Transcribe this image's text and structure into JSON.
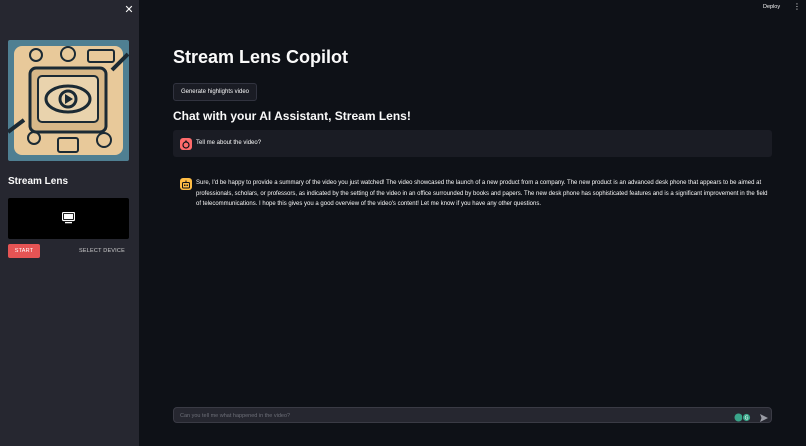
{
  "sidebar": {
    "title": "Stream Lens",
    "start_label": "START",
    "select_device_label": "SELECT DEVICE",
    "close_icon": "close-icon",
    "video_icon": "monitor-icon"
  },
  "topbar": {
    "deploy_label": "Deploy",
    "menu_icon": "vertical-dots-icon"
  },
  "main": {
    "title": "Stream Lens Copilot",
    "highlights_button_label": "Generate highlights video",
    "chat_heading": "Chat with your AI Assistant, Stream Lens!"
  },
  "chat": {
    "messages": [
      {
        "role": "user",
        "avatar_icon": "user-avatar-icon",
        "text": "Tell me about the video?"
      },
      {
        "role": "assistant",
        "avatar_icon": "assistant-avatar-icon",
        "text": "Sure, I'd be happy to provide a summary of the video you just watched! The video showcased the launch of a new product from a company. The new product is an advanced desk phone that appears to be aimed at professionals, scholars, or professors, as indicated by the setting of the video in an office surrounded by books and papers. The new desk phone has sophisticated features and is a significant improvement in the field of telecommunications. I hope this gives you a good overview of the video's content! Let me know if you have any other questions."
      }
    ],
    "input_placeholder": "Can you tell me what happened in the video?",
    "input_value": "",
    "send_icon": "send-icon"
  },
  "colors": {
    "background": "#0e1117",
    "sidebar": "#262730",
    "start_button": "#e55454",
    "user_avatar": "#ff6b6b",
    "assistant_avatar": "#ffbd45"
  }
}
